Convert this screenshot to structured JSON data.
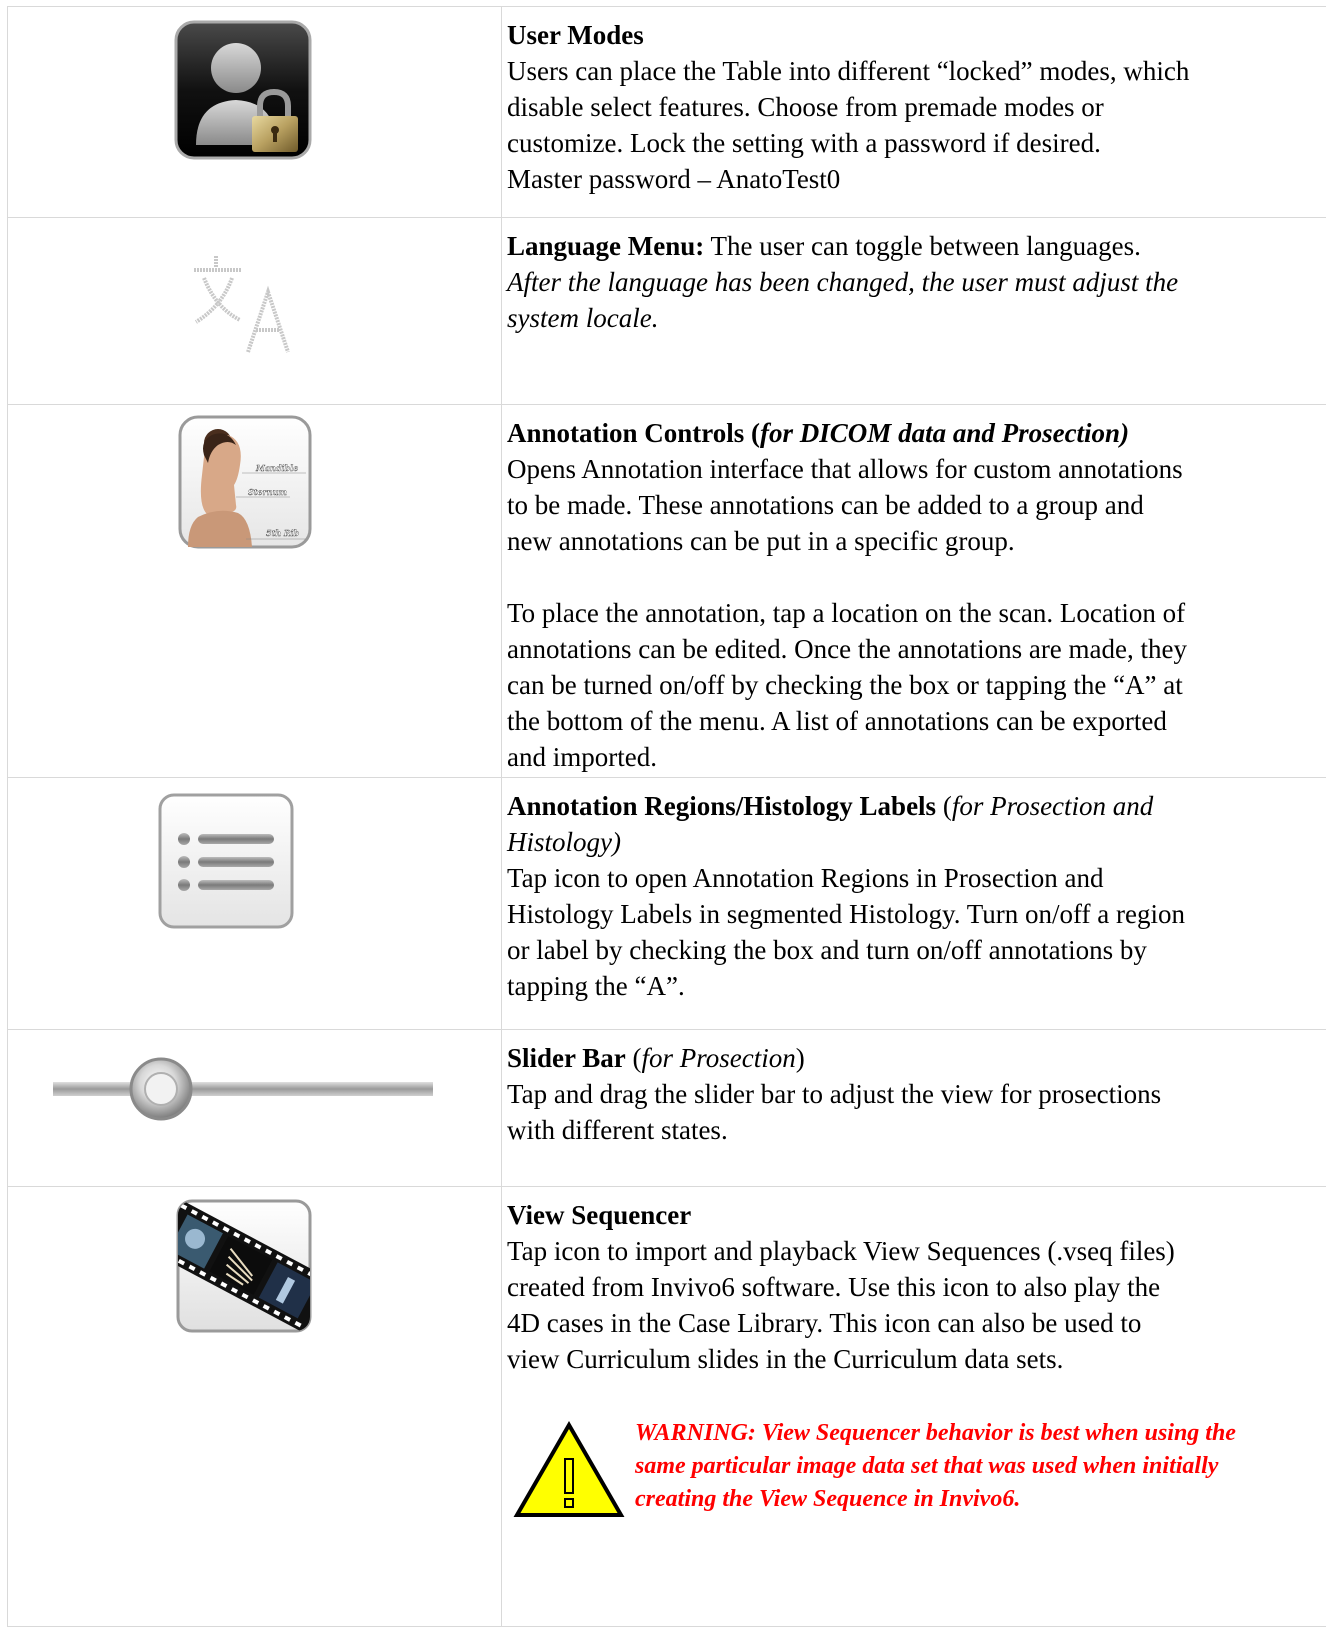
{
  "rows": [
    {
      "icon": "user-lock-icon",
      "title": "User Modes",
      "lines": [
        "Users can place the Table into different “locked” modes, which",
        "disable select features. Choose from premade modes or",
        "customize. Lock the setting with a password if desired.",
        "Master password – AnatoTest0"
      ]
    },
    {
      "icon": "language-icon",
      "title": "Language Menu:",
      "text": " The user can toggle between languages.",
      "italic_lines": [
        "After the language has been changed, the user must adjust the",
        "system locale."
      ]
    },
    {
      "icon": "annotation-head-icon",
      "title": "Annotation Controls (",
      "title_italic": "for DICOM data and Prosection",
      "title_close": ")",
      "lines": [
        "Opens Annotation interface that allows for custom annotations",
        "to be made. These annotations can be added to a group and",
        "new annotations can be put in a specific group."
      ],
      "lines2": [
        "To place the annotation, tap a location on the scan. Location of",
        "annotations can be edited. Once the annotations are made, they",
        "can be turned on/off by checking the box or tapping the “A” at",
        "the bottom of the menu. A list of annotations can be exported",
        "and imported."
      ],
      "icon_labels": [
        "Mandible",
        "Sternum",
        "5th Rib"
      ]
    },
    {
      "icon": "list-icon",
      "title": "Annotation Regions/Histology Labels",
      "title_paren_open": " (",
      "title_italic": "for Prosection and",
      "title_italic2": "Histology)",
      "lines": [
        "Tap icon to open Annotation Regions in Prosection and",
        "Histology Labels in segmented Histology. Turn on/off a region",
        "or label by checking the box and turn on/off annotations by",
        "tapping the “A”."
      ]
    },
    {
      "icon": "slider-icon",
      "title": "Slider Bar",
      "title_paren_open": " (",
      "title_italic": "for Prosection",
      "title_close": ")",
      "lines": [
        "Tap and drag the slider bar to adjust the view for prosections",
        "with different states."
      ]
    },
    {
      "icon": "filmstrip-icon",
      "title": "View Sequencer",
      "lines": [
        "Tap icon to import and playback View Sequences (.vseq files)",
        "created from Invivo6 software. Use this icon to also play the",
        "4D cases in the Case Library. This icon can also be used to",
        "view Curriculum slides in the Curriculum data sets."
      ],
      "warning": [
        "WARNING: View Sequencer behavior is best when using the",
        "same particular image data set that was used when initially",
        "creating the View Sequence in Invivo6."
      ],
      "warning_icon": "warning-triangle-icon"
    }
  ],
  "colors": {
    "warning": "#ff0000",
    "triangle_fill": "#ffff00",
    "border": "#d9d9d9"
  }
}
